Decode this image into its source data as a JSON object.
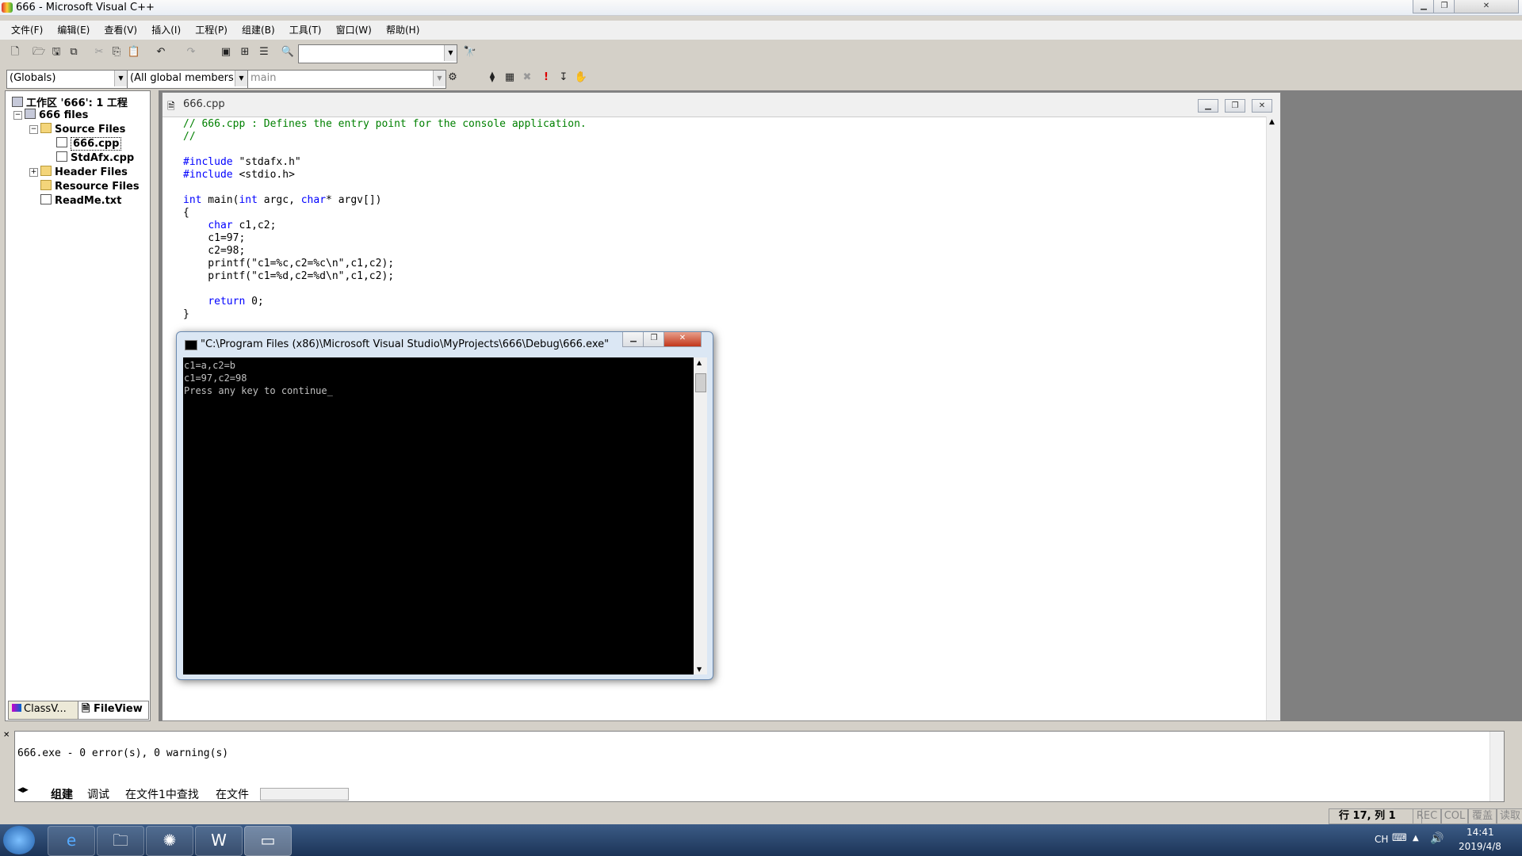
{
  "window": {
    "title": "666 - Microsoft Visual C++"
  },
  "menu": [
    "文件(F)",
    "编辑(E)",
    "查看(V)",
    "插入(I)",
    "工程(P)",
    "组建(B)",
    "工具(T)",
    "窗口(W)",
    "帮助(H)"
  ],
  "toolbar2": {
    "scope": "(Globals)",
    "members": "(All global members",
    "function": "main"
  },
  "workspace": {
    "root": "工作区 '666': 1 工程",
    "project": "666 files",
    "source_folder": "Source Files",
    "file_main": "666.cpp",
    "file_stdafx": "StdAfx.cpp",
    "header_folder": "Header Files",
    "resource_folder": "Resource Files",
    "readme": "ReadMe.txt",
    "tab_class": "ClassV...",
    "tab_file": "FileView"
  },
  "editor": {
    "filename": "666.cpp",
    "lines": [
      {
        "t": "// 666.cpp : Defines the entry point for the console application.",
        "c": "com"
      },
      {
        "t": "//",
        "c": "com"
      },
      {
        "t": "",
        "c": ""
      },
      {
        "t": "#include \"stdafx.h\"",
        "c": "inc"
      },
      {
        "t": "#include <stdio.h>",
        "c": "inc"
      },
      {
        "t": "",
        "c": ""
      },
      {
        "t": "int main(int argc, char* argv[])",
        "c": "main"
      },
      {
        "t": "{",
        "c": ""
      },
      {
        "t": "    char c1,c2;",
        "c": "char"
      },
      {
        "t": "    c1=97;",
        "c": ""
      },
      {
        "t": "    c2=98;",
        "c": ""
      },
      {
        "t": "    printf(\"c1=%c,c2=%c\\n\",c1,c2);",
        "c": ""
      },
      {
        "t": "    printf(\"c1=%d,c2=%d\\n\",c1,c2);",
        "c": ""
      },
      {
        "t": "",
        "c": ""
      },
      {
        "t": "    return 0;",
        "c": "ret"
      },
      {
        "t": "}",
        "c": ""
      }
    ]
  },
  "console": {
    "title": "\"C:\\Program Files (x86)\\Microsoft Visual Studio\\MyProjects\\666\\Debug\\666.exe\"",
    "output": "c1=a,c2=b\nc1=97,c2=98\nPress any key to continue_"
  },
  "output": {
    "text": "666.exe - 0 error(s), 0 warning(s)",
    "tabs": [
      "组建",
      "调试",
      "在文件1中查找",
      "在文件"
    ]
  },
  "status": {
    "position": "行 17, 列 1",
    "rec": "REC",
    "col": "COL",
    "ovr": "覆盖",
    "read": "读取"
  },
  "taskbar": {
    "lang": "CH",
    "time": "14:41",
    "date": "2019/4/8"
  }
}
